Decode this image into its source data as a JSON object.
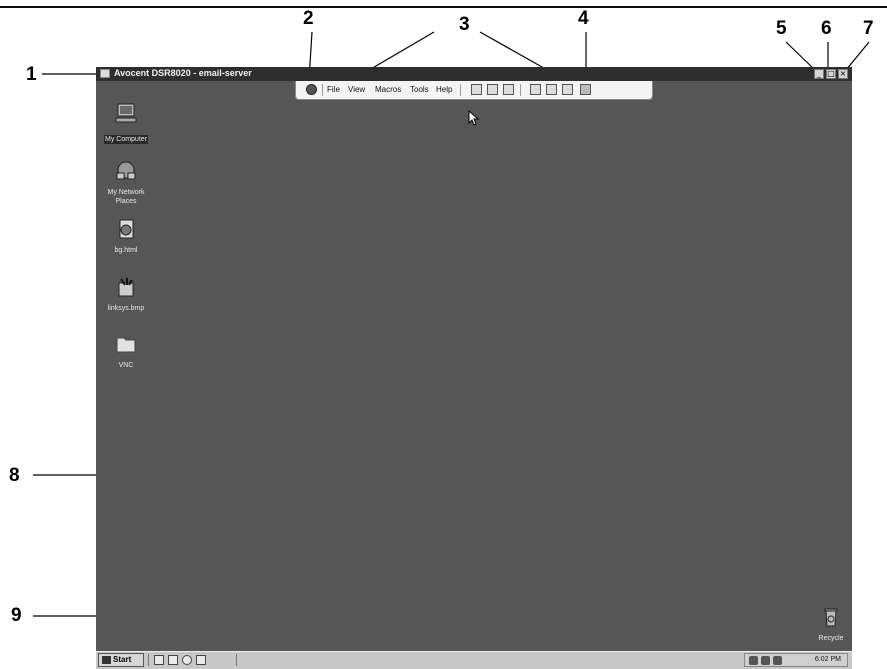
{
  "callouts": [
    "1",
    "2",
    "3",
    "4",
    "5",
    "6",
    "7",
    "8",
    "9"
  ],
  "window": {
    "title": "Avocent DSR8020 - email-server",
    "minimize_glyph": "_",
    "maximize_glyph": "□",
    "close_glyph": "×"
  },
  "toolbar": {
    "menus": [
      "File",
      "View",
      "Macros",
      "Tools",
      "Help"
    ],
    "icons": [
      "connection-icon",
      "single-cursor-icon",
      "refresh-icon",
      "scaling-icon",
      "video-settings-icon",
      "keyboard-icon",
      "mouse-sync-icon",
      "pin-icon"
    ]
  },
  "desktop": {
    "icons": [
      {
        "label": "My Computer",
        "icon": "computer-icon"
      },
      {
        "label": "My Network Places",
        "icon": "network-places-icon"
      },
      {
        "label": "bg.html",
        "icon": "html-file-icon"
      },
      {
        "label": "linksys.bmp",
        "icon": "bitmap-file-icon"
      },
      {
        "label": "VNC",
        "icon": "folder-icon"
      },
      {
        "label": "Recycle",
        "icon": "recycle-bin-icon"
      }
    ]
  },
  "taskbar": {
    "start_label": "Start",
    "clock": "6:02 PM"
  },
  "colors": {
    "desktop": "#565656",
    "titlebar": "#2e2e2e",
    "taskbar": "#c8c8c8"
  }
}
